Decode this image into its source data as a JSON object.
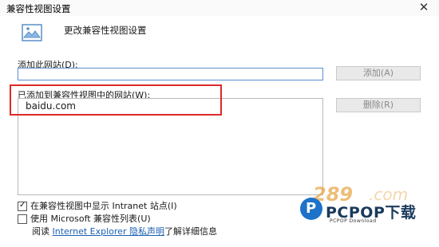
{
  "window": {
    "title": "兼容性视图设置",
    "close_glyph": "✕"
  },
  "header": {
    "text": "更改兼容性视图设置",
    "icon": "picture-icon"
  },
  "add_site": {
    "label": "添加此网站(D):",
    "input_value": "",
    "button_label": "添加(A)"
  },
  "site_list": {
    "label": "已添加到兼容性视图中的网站(W):",
    "items": [
      "baidu.com"
    ],
    "remove_button_label": "删除(R)"
  },
  "options": {
    "intranet": {
      "label": "在兼容性视图中显示 Intranet 站点(I)",
      "checked": true
    },
    "ms_list": {
      "label": "使用 Microsoft 兼容性列表(U)",
      "checked": false
    }
  },
  "read_line": {
    "prefix": "阅读",
    "link_text": "Internet Explorer 隐私声明",
    "suffix": "了解详细信息"
  },
  "watermark": {
    "number_text": "289",
    "com_text": ".com",
    "logo_letter": "P",
    "main_text": "PCPOP下载",
    "sub_text": "PCPOP Download"
  },
  "colors": {
    "highlight": "#e02828",
    "link": "#1a5fb4",
    "input_border": "#5b8fd0"
  }
}
